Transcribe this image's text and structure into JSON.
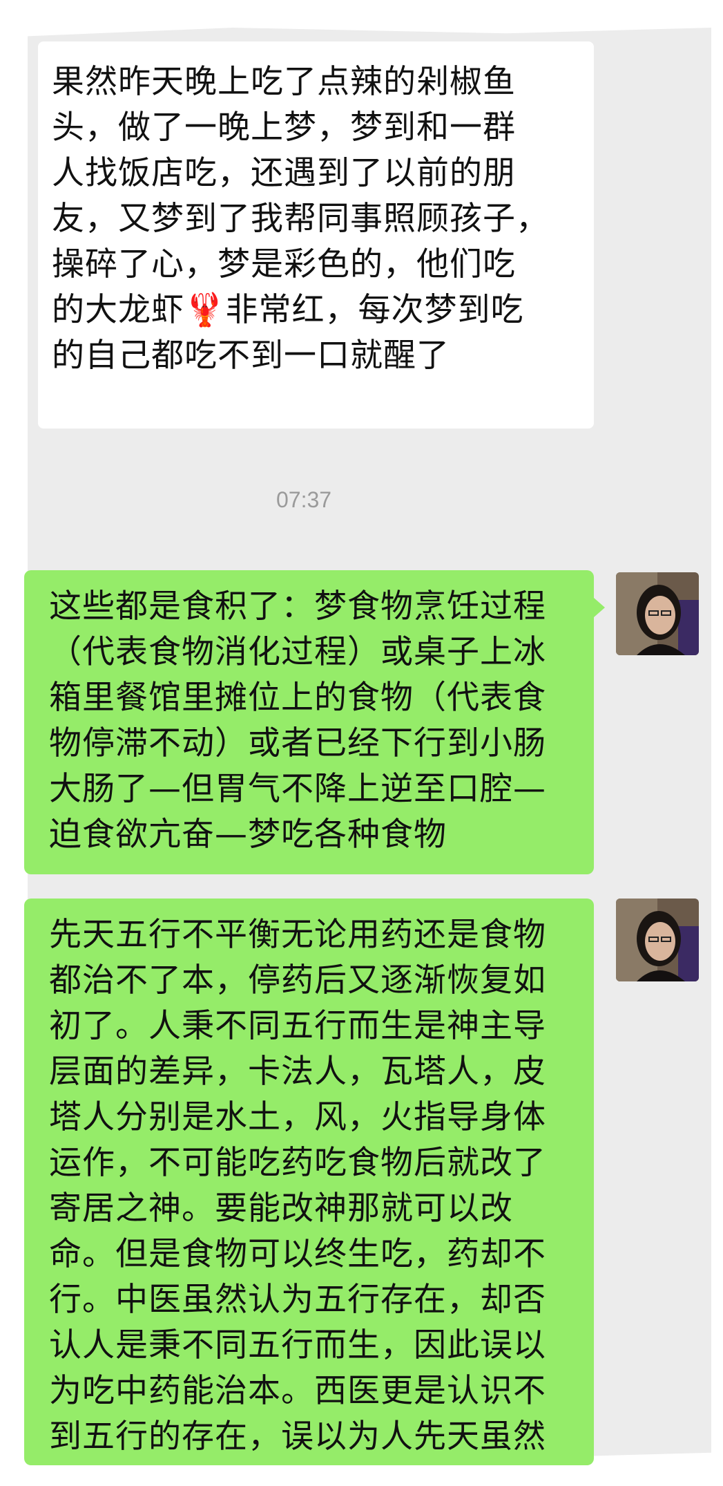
{
  "messages": [
    {
      "sender": "other",
      "lines": [
        "果然昨天晚上吃了点辣的剁椒鱼",
        "头，做了一晚上梦，梦到和一群",
        "人找饭店吃，还遇到了以前的朋",
        "友，又梦到了我帮同事照顾孩子，",
        "操碎了心，梦是彩色的，他们吃",
        "的大龙虾",
        "非常红，每次梦到吃",
        "的自己都吃不到一口就醒了"
      ],
      "emoji": "🦞"
    },
    {
      "sender": "self",
      "lines": [
        "这些都是食积了：梦食物烹饪过程",
        "（代表食物消化过程）或桌子上冰",
        "箱里餐馆里摊位上的食物（代表食",
        "物停滞不动）或者已经下行到小肠",
        "大肠了—但胃气不降上逆至口腔—",
        "迫食欲亢奋—梦吃各种食物"
      ]
    },
    {
      "sender": "self",
      "lines": [
        "先天五行不平衡无论用药还是食物",
        "都治不了本，停药后又逐渐恢复如",
        "初了。人秉不同五行而生是神主导",
        "层面的差异，卡法人，瓦塔人，皮",
        "塔人分别是水土，风，火指导身体",
        "运作，不可能吃药吃食物后就改了",
        "寄居之神。要能改神那就可以改",
        "命。但是食物可以终生吃，药却不",
        "行。中医虽然认为五行存在，却否",
        "认人是秉不同五行而生，因此误以",
        "为吃中药能治本。西医更是认识不",
        "到五行的存在，误以为人先天虽然"
      ]
    }
  ],
  "timestamp": "07:37",
  "colors": {
    "chat_background": "#ececec",
    "incoming_bubble": "#ffffff",
    "outgoing_bubble": "#95ec69",
    "timestamp_text": "#9a9a9a"
  },
  "icons": {
    "avatar": "user-avatar-photo",
    "emoji": "lobster-emoji"
  }
}
